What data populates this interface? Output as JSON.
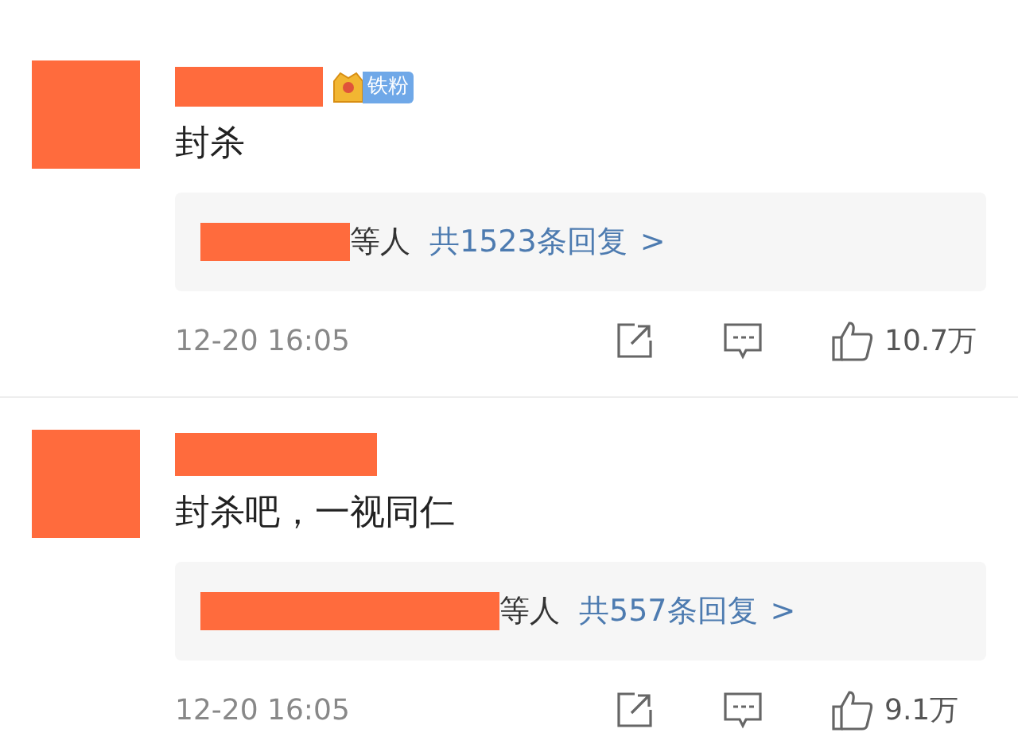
{
  "comments": [
    {
      "badge": "铁粉",
      "text": "封杀",
      "replies": {
        "suffix": "等人",
        "link": "共1523条回复",
        "arrow": ">"
      },
      "time": "12-20 16:05",
      "likes": "10.7万"
    },
    {
      "text": "封杀吧，一视同仁",
      "replies": {
        "suffix": "等人",
        "link": "共557条回复",
        "arrow": ">"
      },
      "time": "12-20 16:05",
      "likes": "9.1万"
    }
  ]
}
